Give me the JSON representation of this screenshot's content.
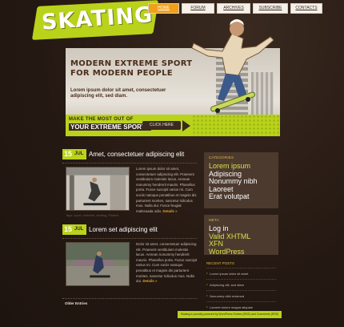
{
  "logo": "SKATING",
  "nav": [
    {
      "label": "HOME"
    },
    {
      "label": "FORUM"
    },
    {
      "label": "ARCHIVES"
    },
    {
      "label": "SUBSCRIBE"
    },
    {
      "label": "CONTACTS"
    }
  ],
  "banner": {
    "title": "MODERN EXTREME SPORT FOR MODERN PEOPLE",
    "subtitle": "Lorem ipsum dolor sit amet, consectetuer adipiscing elit, sed diam.",
    "strip_line1": "MAKE THE MOST OUT OF",
    "strip_line2": "YOUR EXTREME SPORTS",
    "cta": "CLICK HERE"
  },
  "posts": [
    {
      "day": "15",
      "month": "JUL",
      "title": "Amet, consectetuer adipiscing elit",
      "text": "Lorem ipsum dolor sit amet, consectetuer adipiscing elit. Praesent vestibulum molestie lacus. Aenean nonummy hendrerit mauris. Phasellus porta. Fusce suscipit varius mi. Cum sociis natoque penatibus et magnis dis parturient montes, nascetur ridiculus mus. Nulla dui. Fusce feugiat malesuada odio.",
      "details": "Details",
      "meta": "Tags: sport, extreme, skating, Posted"
    },
    {
      "day": "15",
      "month": "JUL",
      "title": "Lorem set adipiscing elit",
      "text": "Dolor sit amet, consectetuer adipiscing elit. Praesent vestibulum molestie lacus. Aenean nonummy hendrerit mauris. Phasellus porta. Fusce suscipit varius mi. Cum sociis natoque penatibus et magnis dis parturient montes, nascetur ridiculus mus. Nulla dui.",
      "details": "Details"
    }
  ],
  "older_entries": "Older Entries",
  "sidebar": {
    "box1_title": "CATEGORIES",
    "box1_links": [
      {
        "label": "Lorem ipsum",
        "accent": true
      },
      {
        "label": "Adipiscing",
        "accent": false
      },
      {
        "label": "Nonummy nibh",
        "accent": false
      },
      {
        "label": "Laoreet",
        "accent": false
      },
      {
        "label": "Erat volutpat",
        "accent": false
      }
    ],
    "box2_title": "META",
    "box2_links": [
      {
        "label": "Log in",
        "accent": false
      },
      {
        "label": "Valid XHTML",
        "accent": true
      },
      {
        "label": "XFN",
        "accent": true
      },
      {
        "label": "WordPress",
        "accent": true
      }
    ],
    "recent_title": "RECENT POSTS",
    "recent_posts": [
      "Lorem ipsum dolor sit amet",
      "Adipiscing elit, sed diam",
      "Nonummy nibh euismod",
      "Laoreet dolore magna aliquam"
    ]
  },
  "footer": "Skating is proudly powered by WordPress Entries (RSS) and Comments (RSS)",
  "colors": {
    "accent": "#b9d21a",
    "background": "#2b1e17",
    "panel": "#4d3a2e",
    "orange": "#f0a019"
  }
}
